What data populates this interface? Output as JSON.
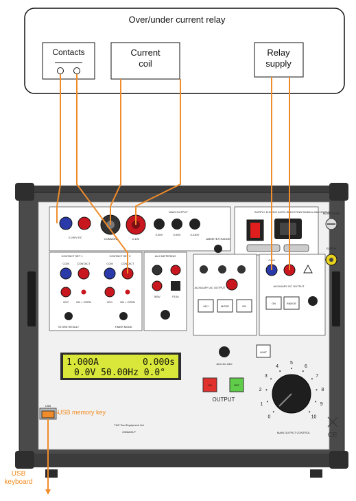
{
  "relay_box": {
    "title": "Over/under current relay",
    "contacts": "Contacts",
    "current_coil_line1": "Current",
    "current_coil_line2": "coil",
    "relay_supply_line1": "Relay",
    "relay_supply_line2": "supply"
  },
  "panel": {
    "dc_range": "0-240V DC",
    "common": "COMMON",
    "range_10v": "0-10V",
    "main_output": "MAIN OUTPUT",
    "range_30v": "0-30V",
    "range_50v": "0-50V",
    "range_240v": "0-240V",
    "ammeter_range": "AMMETER RANGE",
    "supply": "SUPPLY 115/230V AUTO-SELECTING 50/60Hz MAX 2000VA",
    "mains_fuse": "MAINS FUSE",
    "earth": "EARTH",
    "contact_set_1": "CONTACT SET 1",
    "contact_set_2": "CONTACT SET 2",
    "com": "COM",
    "contact": "CONTACT",
    "vdc": "VDC",
    "on_open": "ON = OPEN",
    "aux_metering": "AUX METERING",
    "store_result": "STORE RESULT",
    "timer_mode": "TIMER MODE",
    "aux_ac_output": "AUXILIARY AC OUTPUT",
    "aux_dc_output": "AUXILIARY DC OUTPUT",
    "adj": "ADJ",
    "mode": "MODE",
    "on": "ON",
    "range": "RANGE",
    "limit": "LIMIT",
    "aux_ac_adj": "AUX AC ADJ",
    "output": "OUTPUT",
    "on_button": "ON",
    "off_button": "OFF",
    "brand": "T&R Test Equipment Ltd",
    "model": "200ADM-P",
    "main_output_control": "MAIN OUTPUT CONTROL",
    "usb_port": "USB",
    "ce": "CE",
    "f10a": "F10A",
    "v300": "300V"
  },
  "lcd": {
    "row1_left": "1.000A",
    "row1_right": "0.000s",
    "row2": "0.0V 50.00Hz  0.0°"
  },
  "dial": {
    "ticks": [
      "0",
      "1",
      "2",
      "3",
      "4",
      "5",
      "6",
      "7",
      "8",
      "9",
      "10"
    ]
  },
  "annotations": {
    "usb_memory_key": "USB memory key",
    "usb_keyboard_line1": "USB",
    "usb_keyboard_line2": "keyboard"
  },
  "colors": {
    "wire": "#f08c2a",
    "red_terminal": "#c8171e",
    "blue_terminal": "#2a3aa8",
    "lcd_bg": "#d9e63a",
    "on_button": "#e0312d",
    "off_button": "#5fcc4a"
  }
}
